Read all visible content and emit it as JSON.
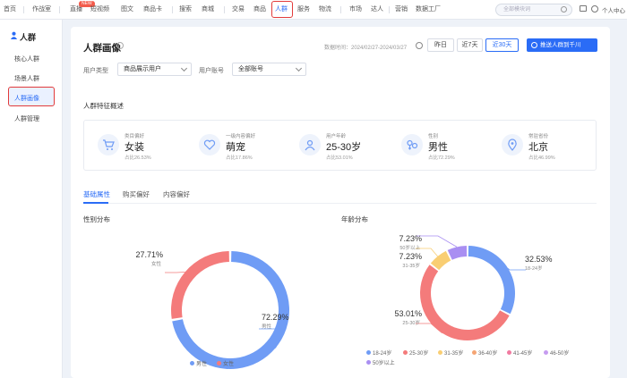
{
  "nav": {
    "items": [
      "首页",
      "作战室",
      "直播",
      "短视频",
      "图文",
      "商品卡",
      "搜索",
      "商城",
      "交易",
      "商品",
      "人群",
      "服务",
      "物流",
      "市场",
      "达人",
      "营销",
      "数据工厂"
    ],
    "active_index": 10,
    "new_badge": "NEW",
    "search_placeholder": "全部模块词",
    "user_label": "个人中心"
  },
  "sidebar": {
    "title": "人群",
    "items": [
      "核心人群",
      "场景人群",
      "人群画像",
      "人群管理"
    ],
    "active_index": 2
  },
  "header": {
    "title": "人群画像",
    "date_label": "数据时间：2024/02/27-2024/03/27",
    "range_buttons": [
      "昨日",
      "近7天",
      "近30天"
    ],
    "selected_range": 2,
    "push_button": "推送人群到千川"
  },
  "filters": {
    "user_type_label": "用户类型",
    "user_type_value": "商品展示用户",
    "account_label": "用户账号",
    "account_value": "全部账号"
  },
  "features": {
    "title": "人群特征概述",
    "items": [
      {
        "label": "类目偏好",
        "value": "女装",
        "sub": "占比26.53%"
      },
      {
        "label": "一级内容偏好",
        "value": "萌宠",
        "sub": "占比17.86%"
      },
      {
        "label": "用户年龄",
        "value": "25-30岁",
        "sub": "占比53.01%"
      },
      {
        "label": "性别",
        "value": "男性",
        "sub": "占比72.29%"
      },
      {
        "label": "常驻省份",
        "value": "北京",
        "sub": "占比46.99%"
      }
    ]
  },
  "tabs": [
    "基础属性",
    "购买偏好",
    "内容偏好"
  ],
  "active_tab": 0,
  "colors": {
    "accent": "#2a6cf6",
    "male": "#6f9cf5",
    "female": "#f47b7b"
  },
  "chart_data": [
    {
      "type": "pie",
      "title": "性别分布",
      "slices": [
        {
          "name": "男性",
          "value": 72.29,
          "label": "72.29%",
          "color": "#6f9cf5"
        },
        {
          "name": "女性",
          "value": 27.71,
          "label": "27.71%",
          "color": "#f47b7b"
        }
      ],
      "legend": [
        "男性",
        "女性"
      ],
      "legend_position": "bottom"
    },
    {
      "type": "pie",
      "title": "年龄分布",
      "slices": [
        {
          "name": "18-24岁",
          "value": 32.53,
          "label": "32.53%",
          "color": "#6f9cf5"
        },
        {
          "name": "25-30岁",
          "value": 53.01,
          "label": "53.01%",
          "color": "#f47b7b"
        },
        {
          "name": "31-35岁",
          "value": 7.23,
          "label": "7.23%",
          "color": "#f9ce73"
        },
        {
          "name": "36-40岁",
          "value": 0,
          "label": "",
          "color": "#f5a574"
        },
        {
          "name": "41-45岁",
          "value": 0,
          "label": "",
          "color": "#f17ba1"
        },
        {
          "name": "46-50岁",
          "value": 0,
          "label": "",
          "color": "#c69cf0"
        },
        {
          "name": "50岁以上",
          "value": 7.23,
          "label": "7.23%",
          "color": "#a98ff2"
        }
      ],
      "legend": [
        "18-24岁",
        "25-30岁",
        "31-35岁",
        "36-40岁",
        "41-45岁",
        "46-50岁",
        "50岁以上"
      ],
      "legend_position": "bottom"
    }
  ]
}
